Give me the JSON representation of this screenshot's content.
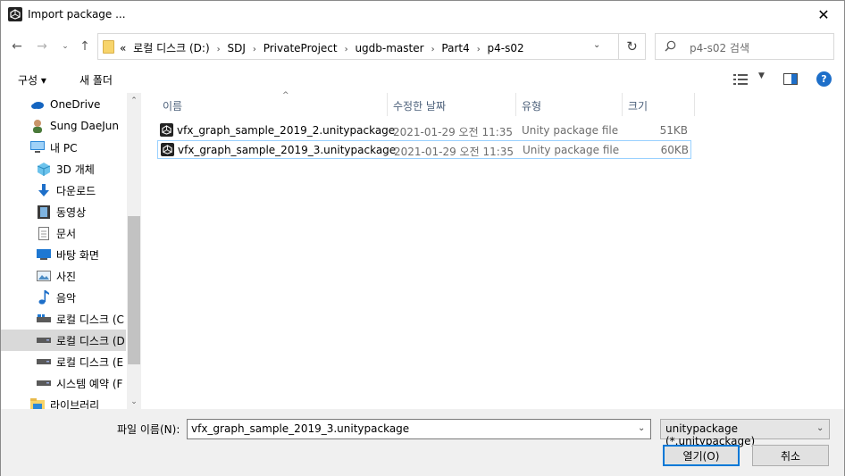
{
  "window": {
    "title": "Import package ...",
    "close_glyph": "✕"
  },
  "nav": {
    "back_icon": "arrow-left-icon",
    "forward_icon": "arrow-right-icon",
    "recent_icon": "chevron-down-icon",
    "up_icon": "arrow-up-icon",
    "breadcrumbs": [
      "«",
      "로컬 디스크 (D:)",
      "SDJ",
      "PrivateProject",
      "ugdb-master",
      "Part4",
      "p4-s02"
    ],
    "search_placeholder": "p4-s02 검색"
  },
  "commands": {
    "organize": "구성 ▾",
    "new_folder": "새 폴더"
  },
  "sidebar": {
    "items": [
      {
        "label": "OneDrive",
        "icon": "cloud-icon"
      },
      {
        "label": "Sung DaeJun",
        "icon": "user-icon"
      },
      {
        "label": "내 PC",
        "icon": "pc-icon"
      },
      {
        "label": "3D 개체",
        "icon": "cube-icon"
      },
      {
        "label": "다운로드",
        "icon": "download-icon"
      },
      {
        "label": "동영상",
        "icon": "video-icon"
      },
      {
        "label": "문서",
        "icon": "document-icon"
      },
      {
        "label": "바탕 화면",
        "icon": "desktop-icon"
      },
      {
        "label": "사진",
        "icon": "picture-icon"
      },
      {
        "label": "음악",
        "icon": "music-icon"
      },
      {
        "label": "로컬 디스크 (C",
        "icon": "drive-icon"
      },
      {
        "label": "로컬 디스크 (D",
        "icon": "drive-icon"
      },
      {
        "label": "로컬 디스크 (E",
        "icon": "drive-icon"
      },
      {
        "label": "시스템 예약 (F",
        "icon": "drive-icon"
      },
      {
        "label": "라이브러리",
        "icon": "library-icon"
      }
    ],
    "selected_index": 11
  },
  "filelist": {
    "columns": {
      "name": "이름",
      "date": "수정한 날짜",
      "type": "유형",
      "size": "크기"
    },
    "rows": [
      {
        "name": "vfx_graph_sample_2019_2.unitypackage",
        "date": "2021-01-29 오전 11:35",
        "type": "Unity package file",
        "size": "51KB"
      },
      {
        "name": "vfx_graph_sample_2019_3.unitypackage",
        "date": "2021-01-29 오전 11:35",
        "type": "Unity package file",
        "size": "60KB"
      }
    ],
    "selected_index": 1
  },
  "bottom": {
    "filename_label": "파일 이름(N):",
    "filename_value": "vfx_graph_sample_2019_3.unitypackage",
    "filetype_value": "unitypackage (*.unitypackage)",
    "open_label": "열기(O)",
    "cancel_label": "취소"
  }
}
